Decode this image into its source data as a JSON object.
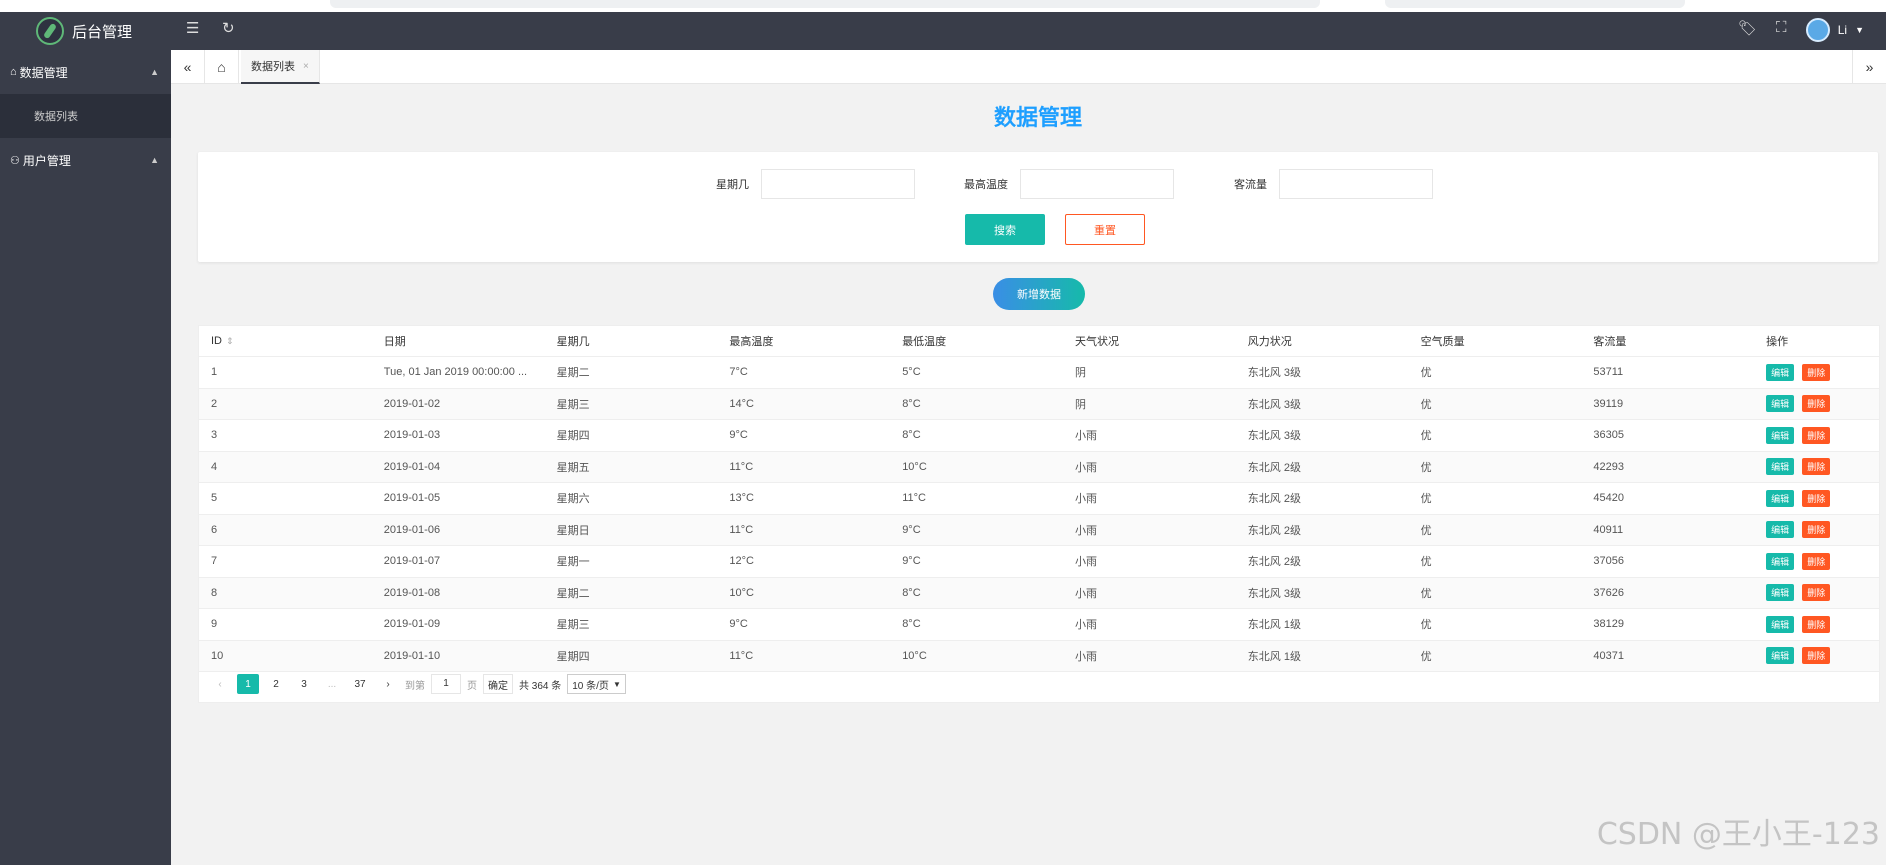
{
  "header": {
    "app_title": "后台管理",
    "user_name": "Li"
  },
  "sidebar": {
    "groups": [
      {
        "label": "数据管理",
        "items": [
          {
            "label": "数据列表"
          }
        ]
      },
      {
        "label": "用户管理",
        "items": []
      }
    ]
  },
  "tabs": {
    "active_tab_label": "数据列表",
    "active_tab_close": "×"
  },
  "main": {
    "page_title": "数据管理",
    "search": {
      "weekday_label": "星期几",
      "max_temp_label": "最高温度",
      "visitors_label": "客流量",
      "search_button": "搜索",
      "reset_button": "重置"
    },
    "add_button": "新增数据",
    "table": {
      "columns": [
        "ID",
        "日期",
        "星期几",
        "最高温度",
        "最低温度",
        "天气状况",
        "风力状况",
        "空气质量",
        "客流量",
        "操作"
      ],
      "edit_label": "编辑",
      "delete_label": "删除",
      "rows": [
        [
          "1",
          "Tue, 01 Jan 2019 00:00:00 ...",
          "星期二",
          "7°C",
          "5°C",
          "阴",
          "东北风 3级",
          "优",
          "53711"
        ],
        [
          "2",
          "2019-01-02",
          "星期三",
          "14°C",
          "8°C",
          "阴",
          "东北风 3级",
          "优",
          "39119"
        ],
        [
          "3",
          "2019-01-03",
          "星期四",
          "9°C",
          "8°C",
          "小雨",
          "东北风 3级",
          "优",
          "36305"
        ],
        [
          "4",
          "2019-01-04",
          "星期五",
          "11°C",
          "10°C",
          "小雨",
          "东北风 2级",
          "优",
          "42293"
        ],
        [
          "5",
          "2019-01-05",
          "星期六",
          "13°C",
          "11°C",
          "小雨",
          "东北风 2级",
          "优",
          "45420"
        ],
        [
          "6",
          "2019-01-06",
          "星期日",
          "11°C",
          "9°C",
          "小雨",
          "东北风 2级",
          "优",
          "40911"
        ],
        [
          "7",
          "2019-01-07",
          "星期一",
          "12°C",
          "9°C",
          "小雨",
          "东北风 2级",
          "优",
          "37056"
        ],
        [
          "8",
          "2019-01-08",
          "星期二",
          "10°C",
          "8°C",
          "小雨",
          "东北风 3级",
          "优",
          "37626"
        ],
        [
          "9",
          "2019-01-09",
          "星期三",
          "9°C",
          "8°C",
          "小雨",
          "东北风 1级",
          "优",
          "38129"
        ],
        [
          "10",
          "2019-01-10",
          "星期四",
          "11°C",
          "10°C",
          "小雨",
          "东北风 1级",
          "优",
          "40371"
        ]
      ]
    },
    "pagination": {
      "pages": [
        "1",
        "2",
        "3",
        "...",
        "37"
      ],
      "current": "1",
      "goto_label": "到第",
      "goto_value": "1",
      "page_unit": "页",
      "confirm_label": "确定",
      "total_text": "共 364 条",
      "page_size": "10 条/页"
    }
  },
  "watermark": "CSDN @王小王-123",
  "colors": {
    "accent": "#16baaa",
    "danger": "#ff5722",
    "title_blue": "#1e9fff",
    "dark_bg": "#393d49"
  }
}
